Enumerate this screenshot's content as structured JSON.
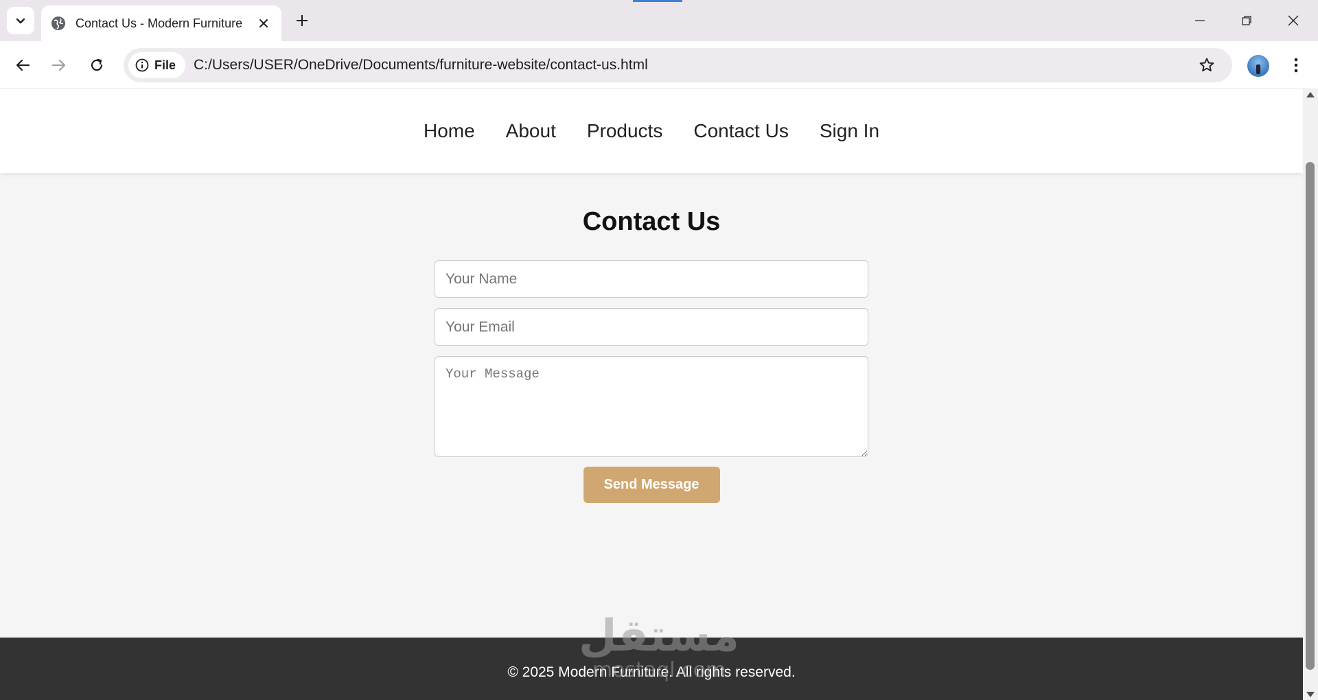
{
  "browser": {
    "tab_title": "Contact Us - Modern Furniture",
    "site_chip_label": "File",
    "url": "C:/Users/USER/OneDrive/Documents/furniture-website/contact-us.html"
  },
  "site": {
    "nav": [
      "Home",
      "About",
      "Products",
      "Contact Us",
      "Sign In"
    ],
    "page_title": "Contact Us",
    "form": {
      "name_placeholder": "Your Name",
      "email_placeholder": "Your Email",
      "message_placeholder": "Your Message",
      "submit_label": "Send Message"
    },
    "footer_text": "© 2025 Modern Furniture. All rights reserved."
  },
  "watermark": {
    "logo_text": "مستقل",
    "domain": "mostaql.com"
  },
  "colors": {
    "accent_button": "#d1a771",
    "footer_bg": "#333333",
    "page_bg": "#f5f5f5"
  }
}
